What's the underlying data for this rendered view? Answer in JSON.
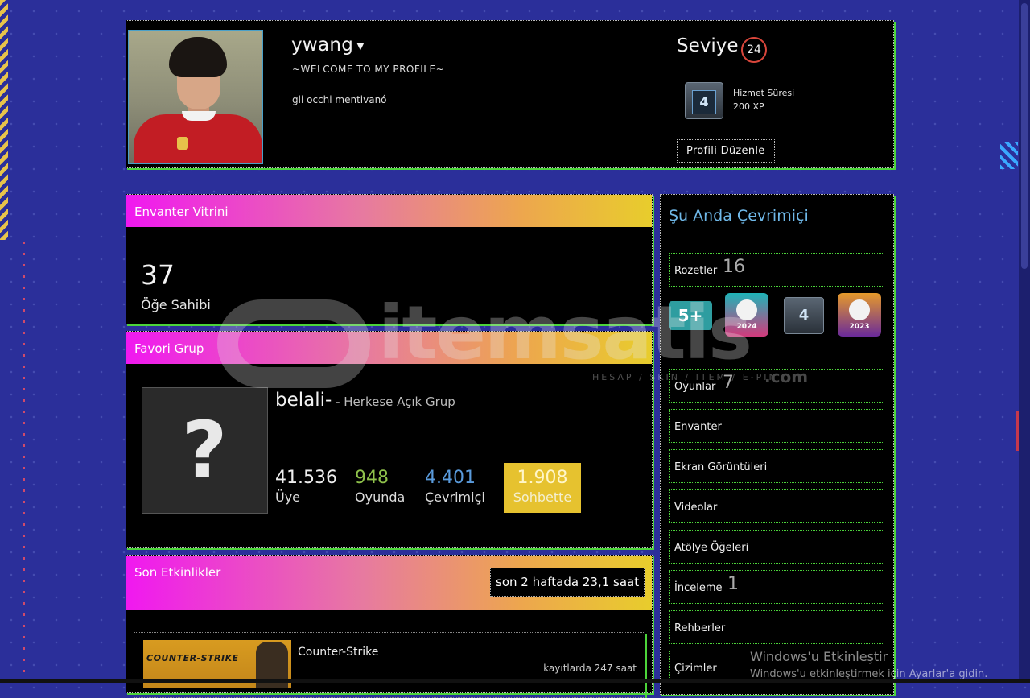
{
  "header": {
    "username": "ywang",
    "welcome": "~WELCOME TO MY PROFILE~",
    "summary": "gli occhi mentivanó",
    "level_label": "Seviye",
    "level": "24",
    "xp_badge_num": "4",
    "xp_badge_title": "Hizmet Süresi",
    "xp_value": "200 XP",
    "edit_button": "Profili Düzenle"
  },
  "inventory": {
    "title": "Envanter Vitrini",
    "count": "37",
    "count_label": "Öğe Sahibi"
  },
  "group": {
    "title": "Favori Grup",
    "avatar_glyph": "?",
    "name": "belali-",
    "type": " - Herkese Açık Grup",
    "stats": [
      {
        "num": "41.536",
        "label": "Üye"
      },
      {
        "num": "948",
        "label": "Oyunda"
      },
      {
        "num": "4.401",
        "label": "Çevrimiçi"
      },
      {
        "num": "1.908",
        "label": "Sohbette"
      }
    ]
  },
  "activity": {
    "title": "Son Etkinlikler",
    "hours": "son 2 haftada 23,1 saat",
    "game": {
      "capsule_text": "COUNTER-STRIKE",
      "name": "Counter-Strike",
      "hours": "kayıtlarda 247 saat"
    }
  },
  "sidebar": {
    "status": "Şu Anda Çevrimiçi",
    "badges_label": "Rozetler",
    "badges_count": "16",
    "badge_items": [
      "5+",
      "2024",
      "4",
      "2023"
    ],
    "links": [
      {
        "label": "Oyunlar",
        "count": "7"
      },
      {
        "label": "Envanter",
        "count": ""
      },
      {
        "label": "Ekran Görüntüleri",
        "count": ""
      },
      {
        "label": "Videolar",
        "count": ""
      },
      {
        "label": "Atölye Öğeleri",
        "count": ""
      },
      {
        "label": "İnceleme",
        "count": "1"
      },
      {
        "label": "Rehberler",
        "count": ""
      },
      {
        "label": "Çizimler",
        "count": ""
      }
    ]
  },
  "watermark": {
    "brand": "itemsatis",
    "sub": "HESAP / SKIN / ITEM / E-PIN",
    "domain": ".com"
  },
  "os_notice": {
    "title": "Windows'u Etkinleştir",
    "body": "Windows'u etkinleştirmek için Ayarlar'a gidin."
  },
  "colors": {
    "page_bg": "#2b2f9a",
    "panel_border_accent": "#4cd43a",
    "header_gradient_start": "#f018f0",
    "header_gradient_end": "#e8cd2c",
    "level_ring": "#d9463b",
    "status_blue": "#6fb8e8"
  }
}
